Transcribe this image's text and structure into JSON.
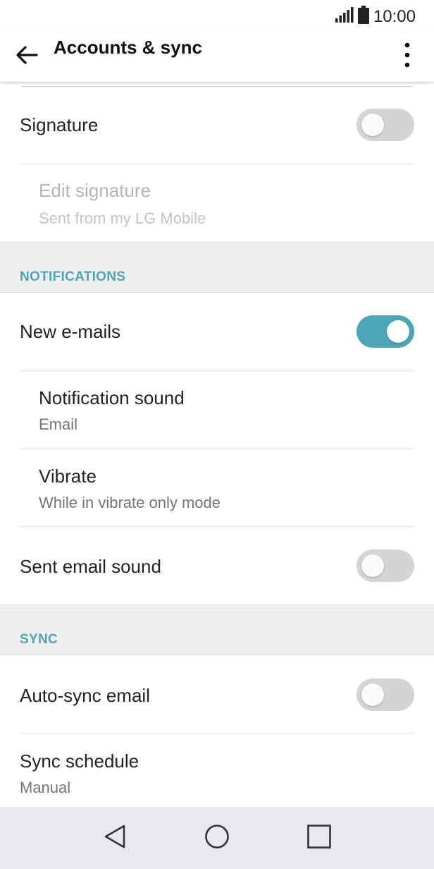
{
  "status_bar": {
    "time": "10:00",
    "icons": [
      "signal-icon",
      "battery-icon"
    ]
  },
  "app_bar": {
    "title": "Accounts & sync",
    "icons": [
      "back-arrow-icon",
      "overflow-menu-icon"
    ]
  },
  "rows": {
    "signature": {
      "label": "Signature",
      "toggle_on": false
    },
    "edit_signature": {
      "label": "Edit signature",
      "value": "Sent from my LG Mobile",
      "enabled": false
    },
    "new_emails": {
      "label": "New e-mails",
      "toggle_on": true
    },
    "notification_sound": {
      "label": "Notification sound",
      "value": "Email"
    },
    "vibrate": {
      "label": "Vibrate",
      "value": "While in vibrate only mode"
    },
    "sent_email_sound": {
      "label": "Sent email sound",
      "toggle_on": false
    },
    "auto_sync": {
      "label": "Auto-sync email",
      "toggle_on": false
    },
    "sync_schedule": {
      "label": "Sync schedule",
      "value": "Manual"
    }
  },
  "sections": {
    "notifications": "NOTIFICATIONS",
    "sync": "SYNC"
  },
  "colors": {
    "accent": "#4ba6b8",
    "toggle_off": "#d4d4d4",
    "section_bg": "#efefef",
    "nav_bg": "#e8e9ec"
  },
  "nav_bar": {
    "icons": [
      "back-triangle-icon",
      "home-circle-icon",
      "recents-square-icon"
    ]
  }
}
